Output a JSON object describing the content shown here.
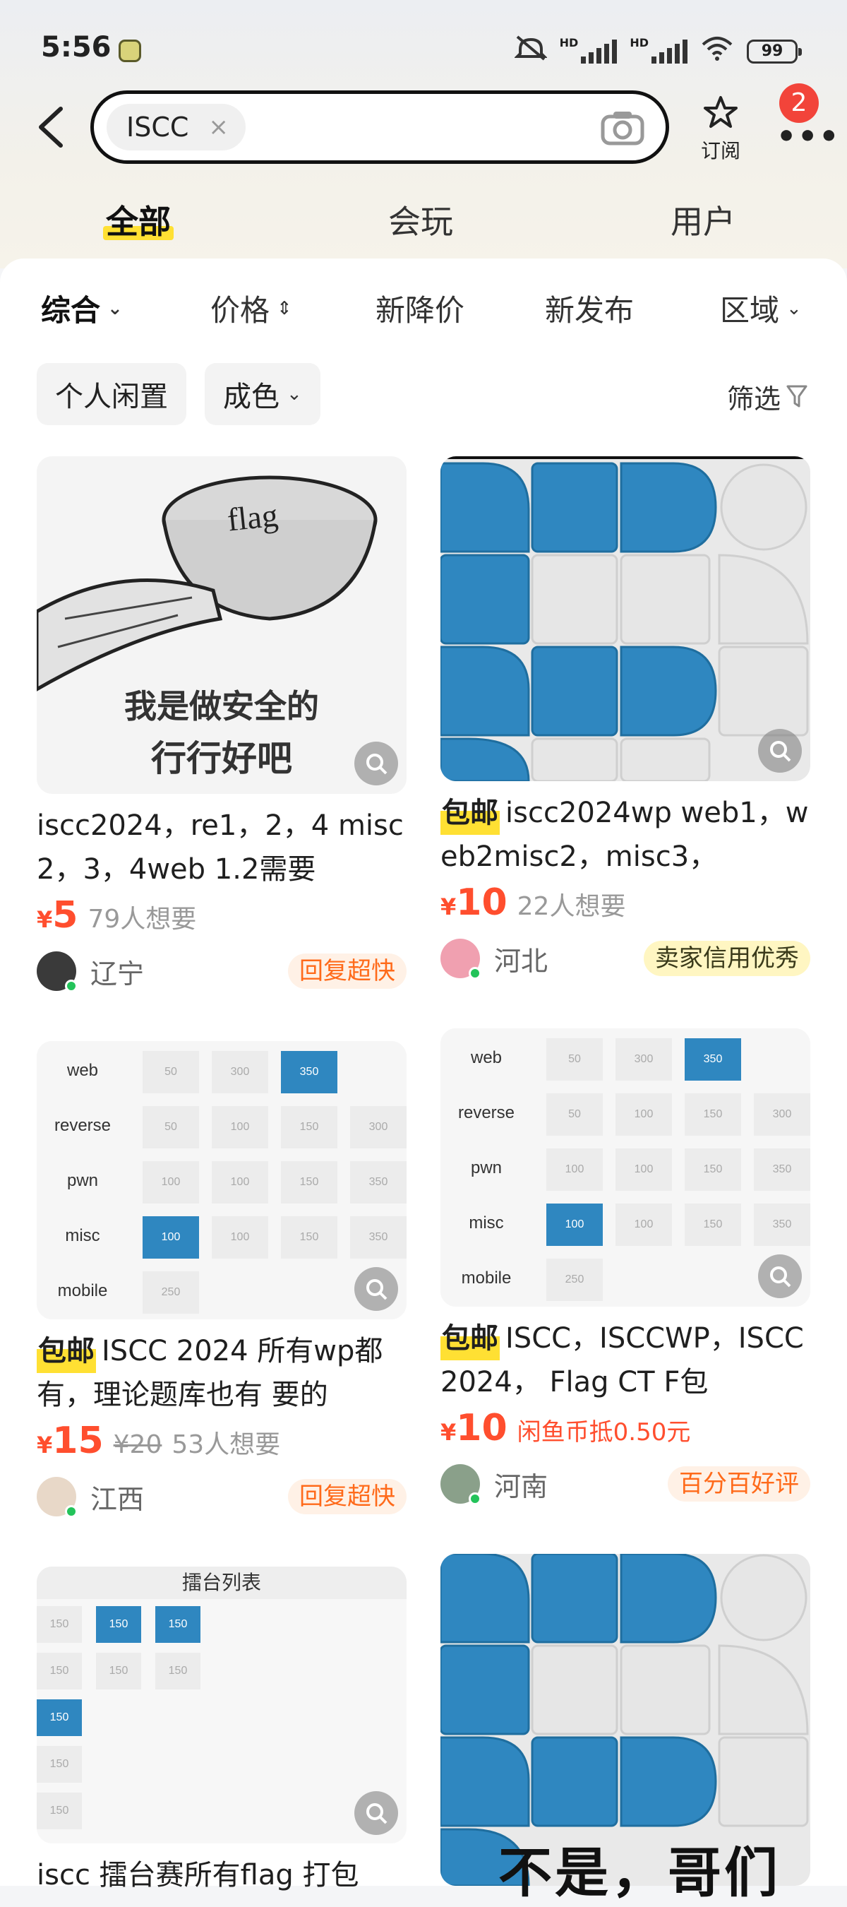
{
  "status_bar": {
    "time": "5:56",
    "battery": "99",
    "hd1": "HD",
    "hd2": "HD"
  },
  "search": {
    "query": "ISCC",
    "clear": "×"
  },
  "header": {
    "subscribe_label": "订阅",
    "more_badge": "2"
  },
  "tabs": [
    "全部",
    "会玩",
    "用户"
  ],
  "sort_bar": [
    "综合",
    "价格",
    "新降价",
    "新发布",
    "区域"
  ],
  "filters": {
    "chips": [
      "个人闲置",
      "成色"
    ],
    "screen": "筛选"
  },
  "products": [
    {
      "image_caption_1": "我是做安全的",
      "image_caption_2": "行行好吧",
      "image_bowl_text": "flag",
      "title": "iscc2024，re1，2，4 misc2，3，4web 1.2需要",
      "free_shipping": "",
      "price_symbol": "¥",
      "price": "5",
      "orig_price": "",
      "want": "79人想要",
      "region": "辽宁",
      "seller_tag": "回复超快"
    },
    {
      "title": "iscc2024wp web1，web2misc2，misc3，",
      "free_shipping": "包邮",
      "price_symbol": "¥",
      "price": "10",
      "want": "22人想要",
      "region": "河北",
      "seller_tag": "卖家信用优秀"
    },
    {
      "table_rows": [
        {
          "cat": "web",
          "cells": [
            "50",
            "300",
            "350"
          ]
        },
        {
          "cat": "reverse",
          "cells": [
            "50",
            "100",
            "150",
            "300"
          ]
        },
        {
          "cat": "pwn",
          "cells": [
            "100",
            "100",
            "150",
            "350"
          ]
        },
        {
          "cat": "misc",
          "cells": [
            "100",
            "100",
            "150",
            "350"
          ]
        },
        {
          "cat": "mobile",
          "cells": [
            "250"
          ]
        }
      ],
      "title": "ISCC  2024 所有wp都有，理论题库也有 要的",
      "free_shipping": "包邮",
      "price_symbol": "¥",
      "price": "15",
      "orig_price": "¥20",
      "want": "53人想要",
      "region": "江西",
      "seller_tag": "回复超快"
    },
    {
      "table_rows": [
        {
          "cat": "web",
          "cells": [
            "50",
            "300",
            "350"
          ]
        },
        {
          "cat": "reverse",
          "cells": [
            "50",
            "100",
            "150",
            "300"
          ]
        },
        {
          "cat": "pwn",
          "cells": [
            "100",
            "100",
            "150",
            "350"
          ]
        },
        {
          "cat": "misc",
          "cells": [
            "100",
            "100",
            "150",
            "350"
          ]
        },
        {
          "cat": "mobile",
          "cells": [
            "250"
          ]
        }
      ],
      "title": "ISCC，ISCCWP，ISCC2024， Flag CT F包",
      "free_shipping": "包邮",
      "price_symbol": "¥",
      "price": "10",
      "coin_note": "闲鱼币抵0.50元",
      "region": "河南",
      "seller_tag": "百分百好评"
    },
    {
      "image_header": "擂台列表",
      "cells": [
        "150",
        "150",
        "150",
        "150",
        "150",
        "150",
        "150",
        "150",
        "150"
      ],
      "title": "iscc 擂台赛所有flag 打包"
    },
    {
      "overlay_text": "不是，哥们"
    }
  ],
  "colors": {
    "accent_yellow": "#ffe033",
    "price_red": "#ff4e2e",
    "tile_blue": "#2f87c0",
    "badge_red": "#f2443a"
  }
}
